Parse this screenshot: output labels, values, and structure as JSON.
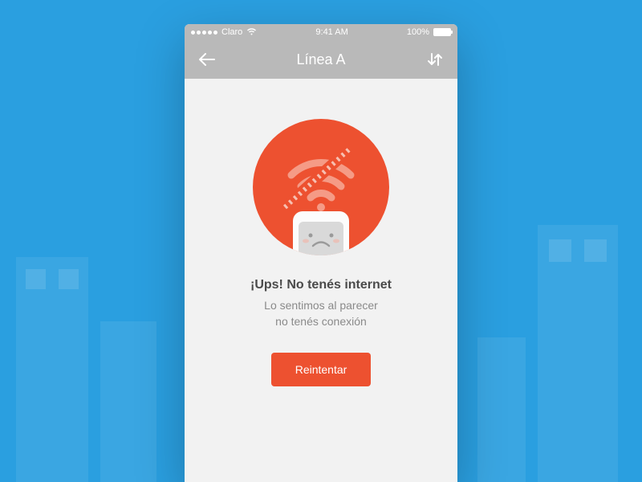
{
  "statusBar": {
    "carrier": "Claro",
    "time": "9:41 AM",
    "battery": "100%"
  },
  "navBar": {
    "title": "Línea A"
  },
  "error": {
    "heading": "¡Ups! No tenés internet",
    "subLine1": "Lo sentimos al parecer",
    "subLine2": "no tenés conexión",
    "retryLabel": "Reintentar"
  },
  "colors": {
    "accent": "#ed5130",
    "bg": "#2a9fe0"
  }
}
